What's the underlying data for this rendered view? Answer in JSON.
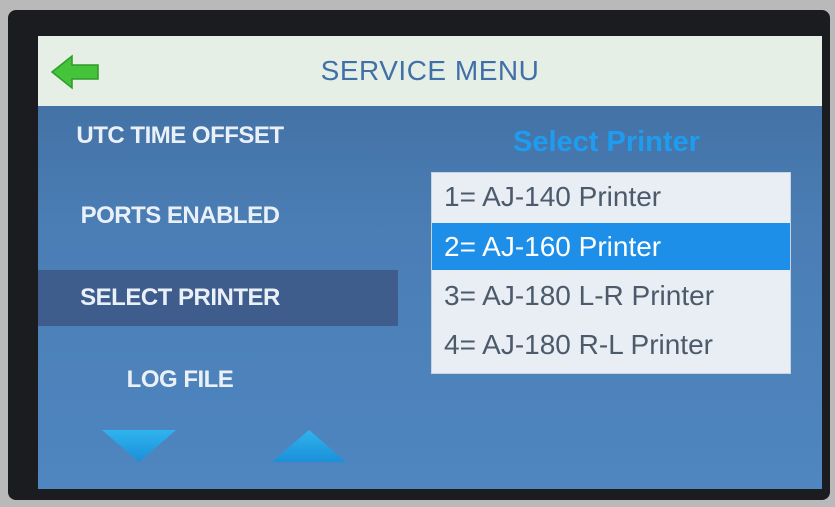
{
  "header": {
    "title": "SERVICE MENU",
    "back_icon": "back-arrow-icon"
  },
  "menu": {
    "items": [
      {
        "label": "UTC TIME OFFSET",
        "selected": false
      },
      {
        "label": "PORTS ENABLED",
        "selected": false
      },
      {
        "label": "SELECT PRINTER",
        "selected": true
      },
      {
        "label": "LOG FILE",
        "selected": false
      }
    ],
    "scroll_down_icon": "triangle-down-icon",
    "scroll_up_icon": "triangle-up-icon"
  },
  "printer_panel": {
    "title": "Select Printer",
    "options": [
      {
        "label": "1= AJ-140 Printer",
        "selected": false
      },
      {
        "label": "2= AJ-160 Printer",
        "selected": true
      },
      {
        "label": "3= AJ-180 L-R Printer",
        "selected": false
      },
      {
        "label": "4= AJ-180 R-L Printer",
        "selected": false
      }
    ]
  },
  "colors": {
    "header_bg": "#e6efe6",
    "title_text": "#4170a8",
    "screen_bg": "#4a7db4",
    "accent": "#1e8fe8",
    "back_arrow": "#3fbf3f"
  }
}
